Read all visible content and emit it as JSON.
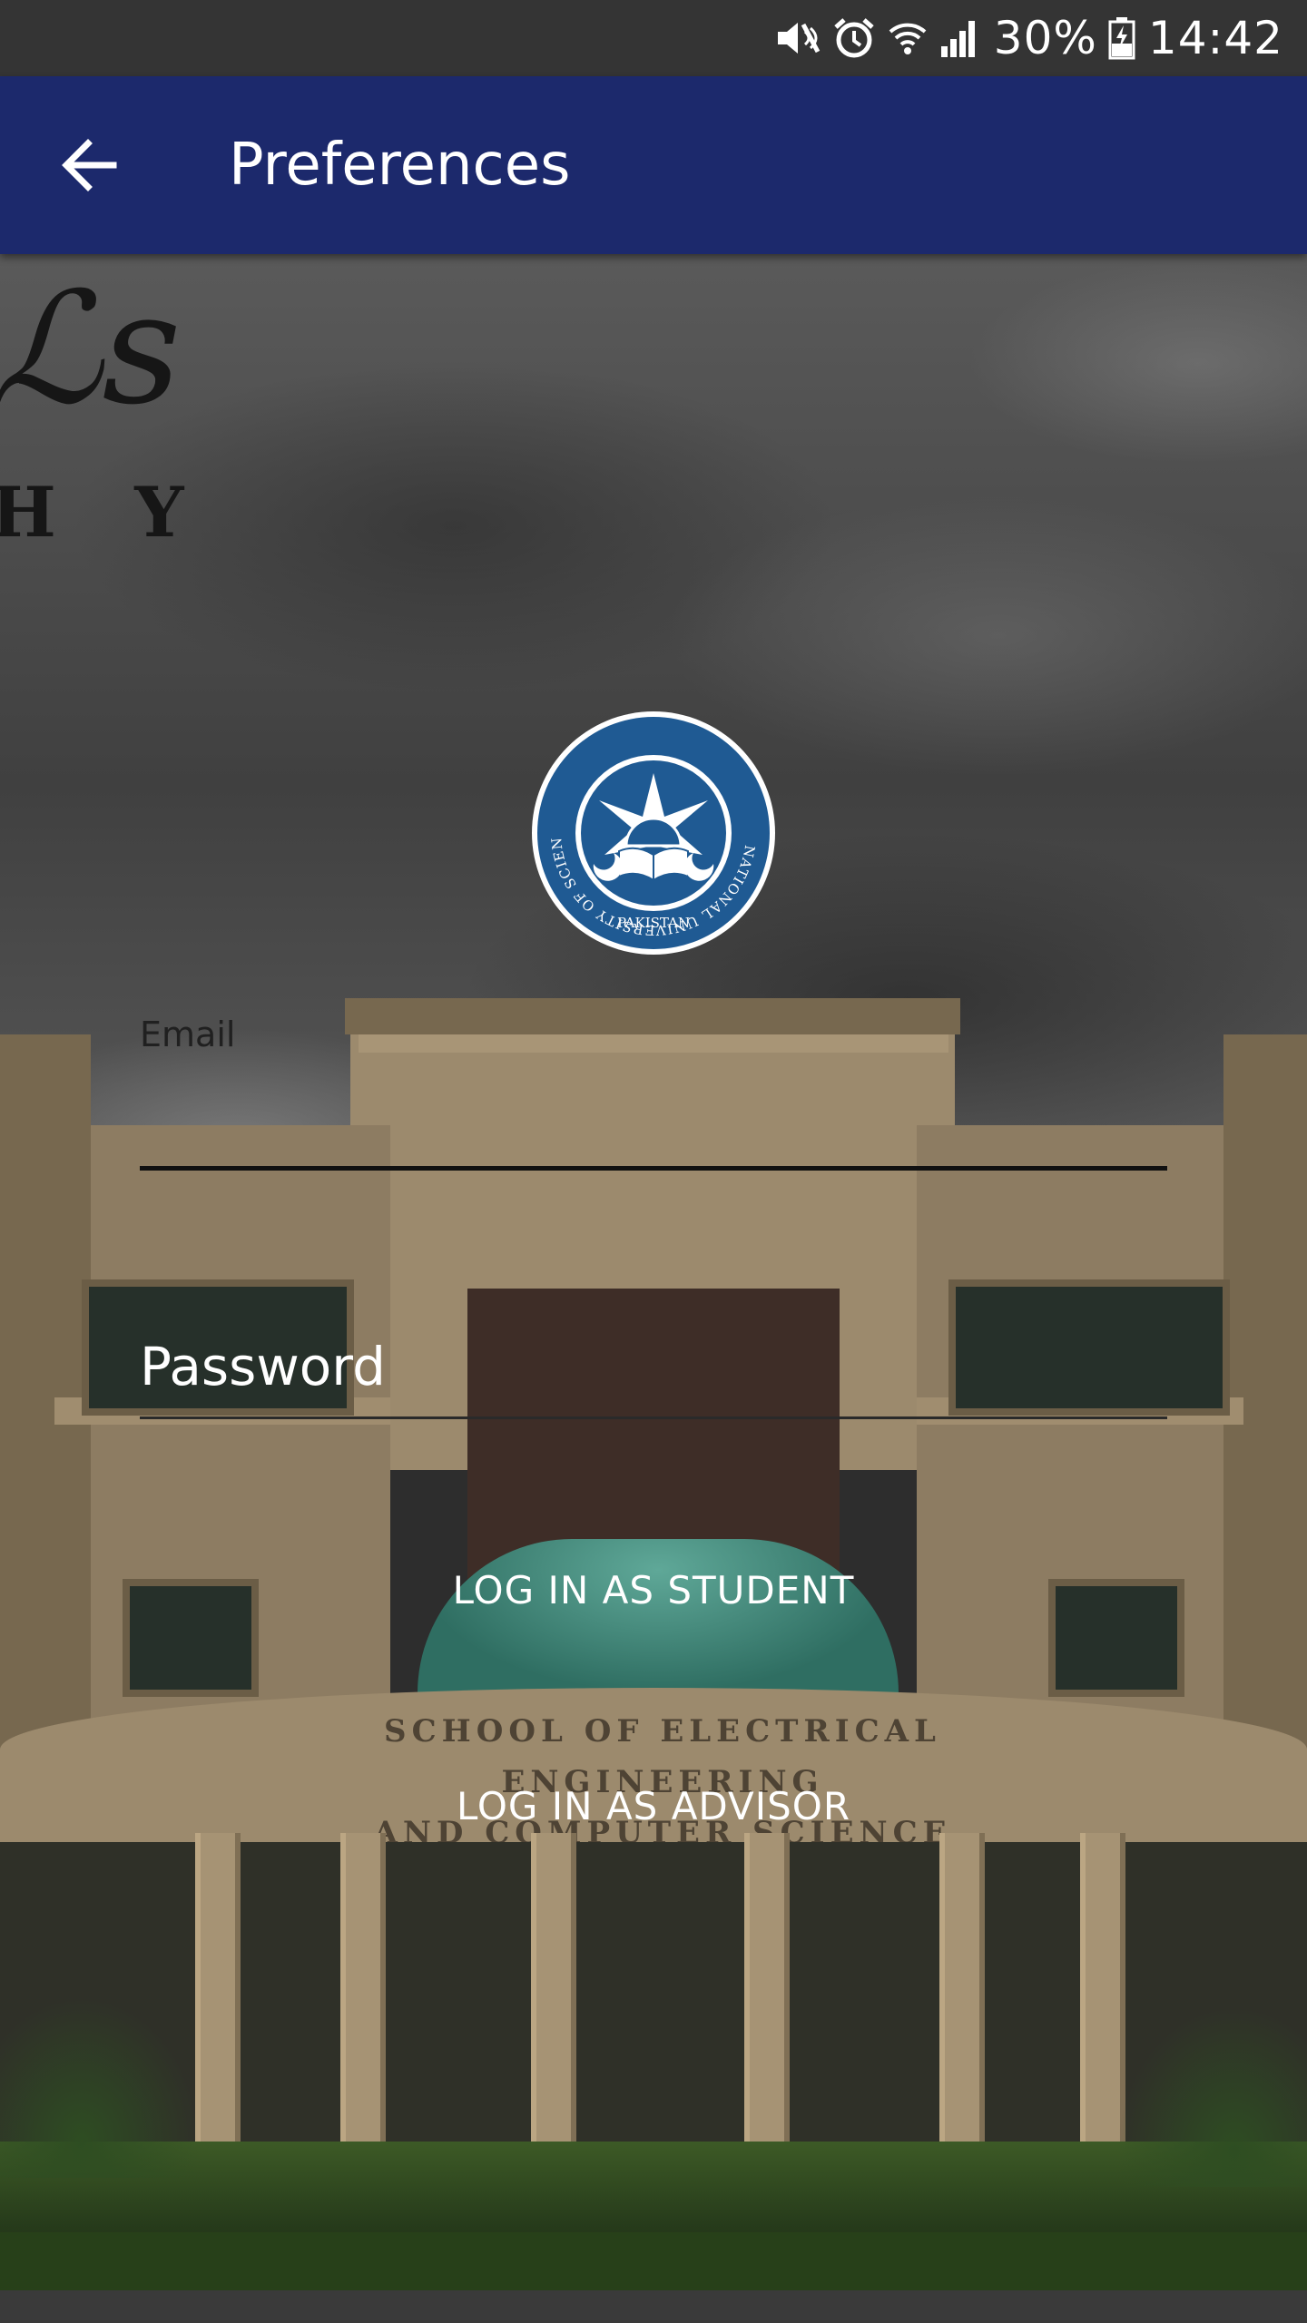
{
  "status_bar": {
    "battery": "30%",
    "time": "14:42",
    "icons": [
      "mute-icon",
      "alarm-icon",
      "wifi-icon",
      "signal-icon",
      "battery-charging-icon"
    ]
  },
  "app_bar": {
    "title": "Preferences",
    "back_icon": "arrow-left-icon",
    "background_color": "#1c296c"
  },
  "background": {
    "description_icon": "campus-building-photo",
    "watermark_letters": "H Y"
  },
  "logo": {
    "icon": "nust-seal-logo",
    "ring_text": "NATIONAL UNIVERSITY OF SCIENCES & TECHNOLOGY",
    "bottom_text": "PAKISTAN"
  },
  "form": {
    "email_label": "Email",
    "email_value": "",
    "password_placeholder": "Password"
  },
  "actions": {
    "student_login": "LOG IN AS STUDENT",
    "advisor_login": "LOG IN AS ADVISOR"
  },
  "colors": {
    "app_bar": "#1c296c",
    "status_bar": "#343434",
    "seal_blue": "#1f5a93"
  }
}
